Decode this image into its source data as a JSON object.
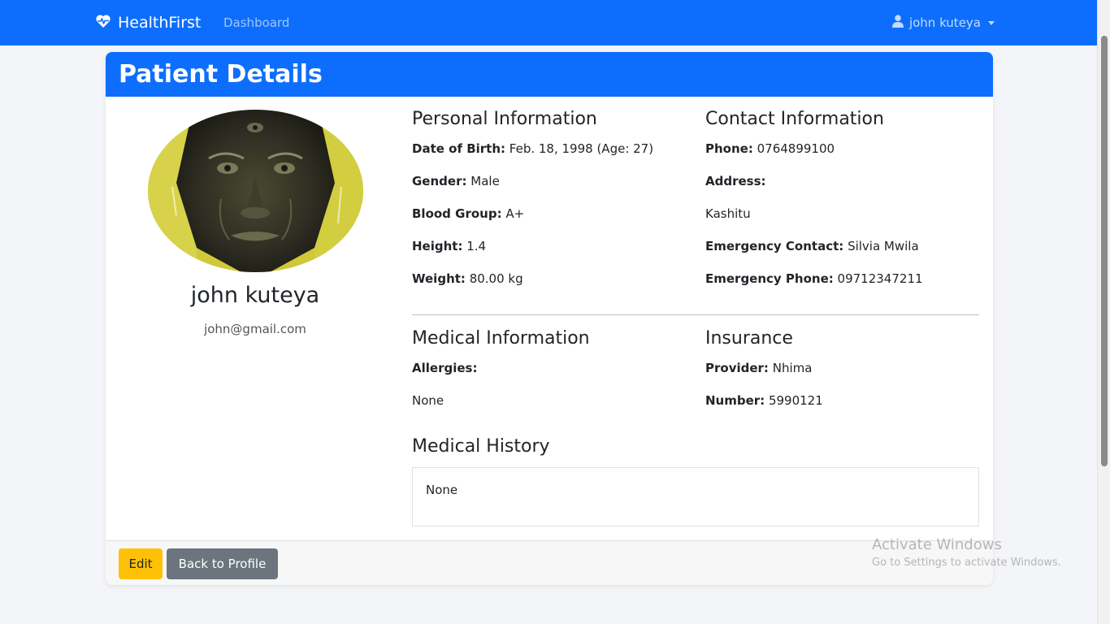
{
  "navbar": {
    "brand": "HealthFirst",
    "brand_icon": "heart-pulse-icon",
    "links": [
      "Dashboard"
    ],
    "user": "john kuteya",
    "bg_color": "#0d6efd"
  },
  "card": {
    "header_title": "Patient Details",
    "patient": {
      "name": "john kuteya",
      "email": "john@gmail.com"
    },
    "personal": {
      "title": "Personal Information",
      "dob_label": "Date of Birth:",
      "dob_value": "Feb. 18, 1998 (Age: 27)",
      "gender_label": "Gender:",
      "gender_value": "Male",
      "blood_label": "Blood Group:",
      "blood_value": "A+",
      "height_label": "Height:",
      "height_value": "1.4",
      "weight_label": "Weight:",
      "weight_value": "80.00 kg"
    },
    "contact": {
      "title": "Contact Information",
      "phone_label": "Phone:",
      "phone_value": "0764899100",
      "address_label": "Address:",
      "address_value": "Kashitu",
      "emergency_contact_label": "Emergency Contact:",
      "emergency_contact_value": "Silvia Mwila",
      "emergency_phone_label": "Emergency Phone:",
      "emergency_phone_value": "09712347211"
    },
    "medical": {
      "title": "Medical Information",
      "allergies_label": "Allergies:",
      "allergies_value": "None"
    },
    "insurance": {
      "title": "Insurance",
      "provider_label": "Provider:",
      "provider_value": "Nhima",
      "number_label": "Number:",
      "number_value": "5990121"
    },
    "history": {
      "title": "Medical History",
      "value": "None"
    },
    "footer": {
      "edit_label": "Edit",
      "back_label": "Back to Profile"
    }
  },
  "watermark": {
    "title": "Activate Windows",
    "subtitle": "Go to Settings to activate Windows."
  }
}
